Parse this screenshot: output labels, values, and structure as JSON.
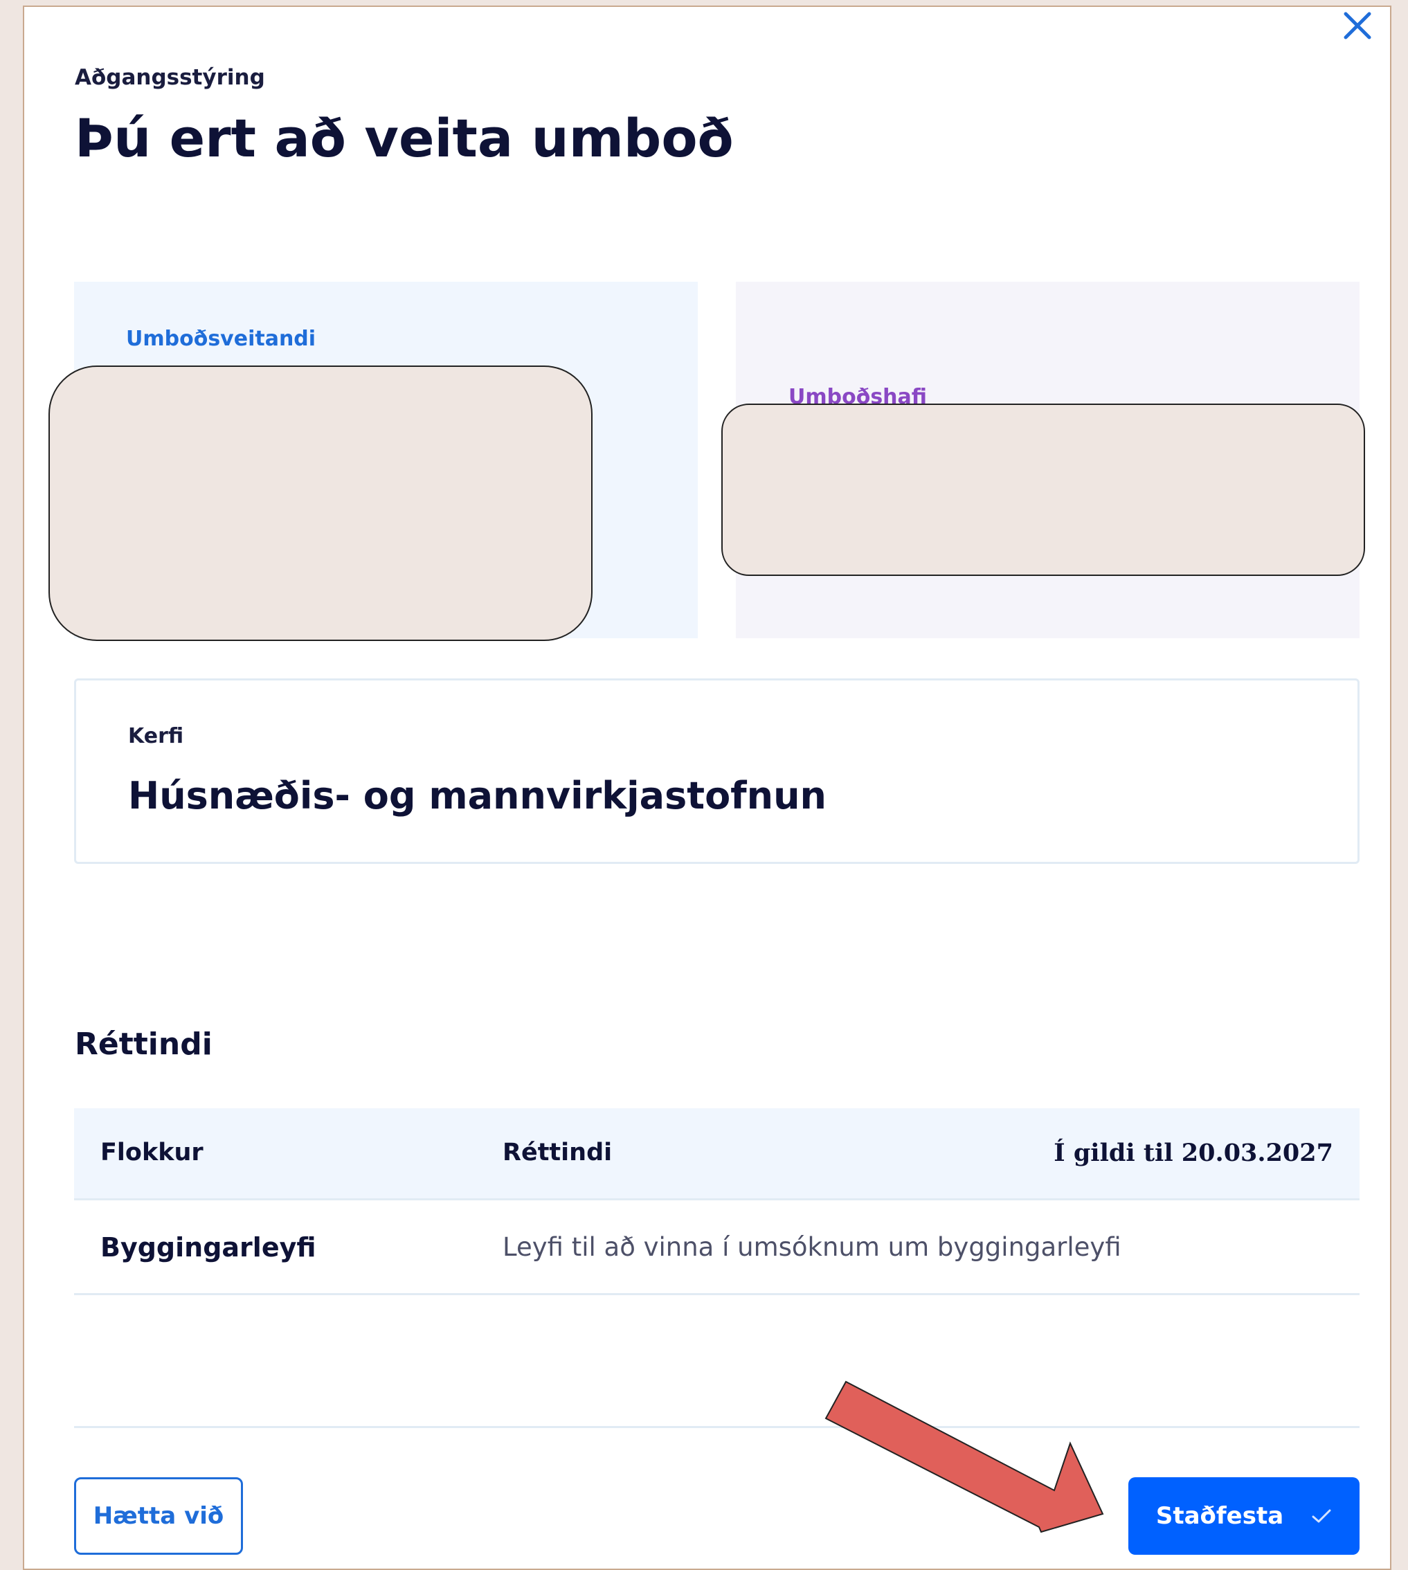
{
  "dialog": {
    "eyebrow": "Aðgangsstýring",
    "title": "Þú ert að veita umboð",
    "close_icon": "close-icon"
  },
  "parties": {
    "giver_label": "Umboðsveitandi",
    "holder_label": "Umboðshafi"
  },
  "system": {
    "label": "Kerfi",
    "value": "Húsnæðis- og mannvirkjastofnun"
  },
  "rights": {
    "section_title": "Réttindi",
    "columns": [
      "Flokkur",
      "Réttindi",
      "Í gildi til 20.03.2027"
    ],
    "rows": [
      {
        "category": "Byggingarleyfi",
        "description": "Leyfi til að vinna í umsóknum um byggingarleyfi"
      }
    ]
  },
  "footer": {
    "cancel_label": "Hætta við",
    "confirm_label": "Staðfesta",
    "confirm_icon": "check-icon"
  },
  "colors": {
    "primary": "#0061ff",
    "accent_blue": "#1f6dd9",
    "accent_purple": "#8a48c4",
    "annotation_arrow": "#e0605a",
    "redaction": "#efe6e1"
  }
}
